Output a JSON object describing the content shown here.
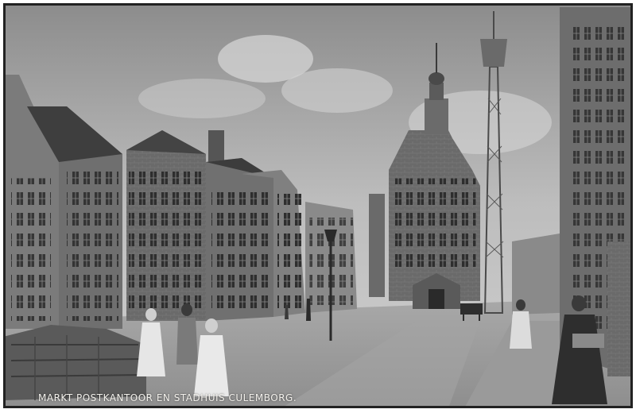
{
  "caption": "MARKT POSTKANTOOR EN STADHUIS CULEMBORG."
}
